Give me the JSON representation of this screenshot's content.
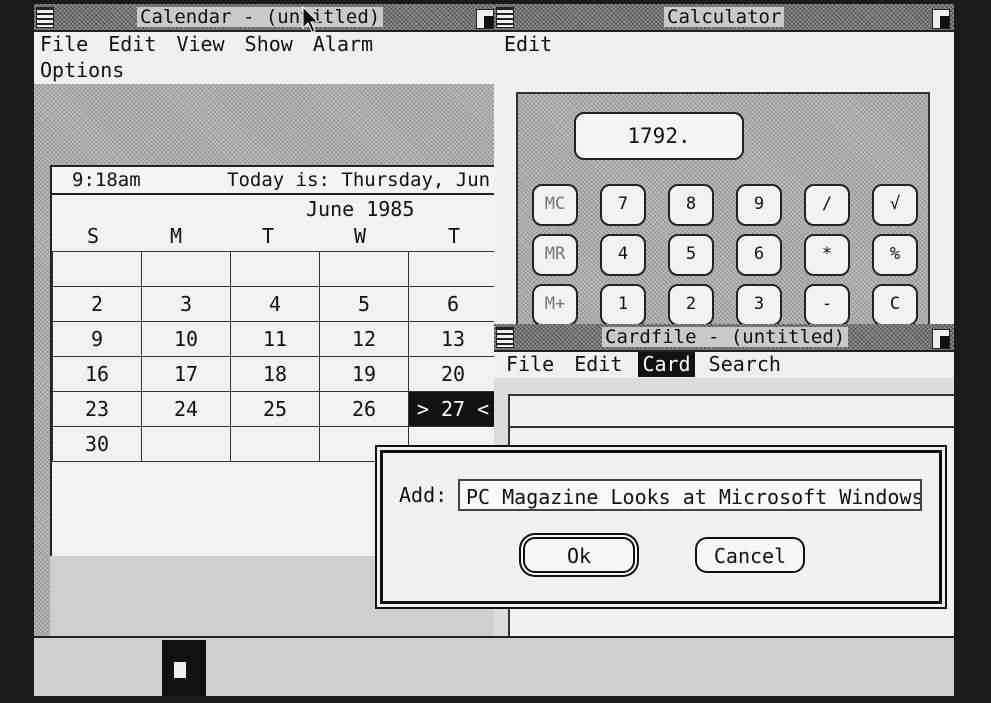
{
  "calendar": {
    "title": "Calendar - (untitled)",
    "menu": [
      "File",
      "Edit",
      "View",
      "Show",
      "Alarm"
    ],
    "menu2": "Options",
    "time": "9:18am",
    "today_text": "Today is: Thursday, Jun",
    "month": "June 1985",
    "weekdays": [
      "S",
      "M",
      "T",
      "W",
      "T"
    ],
    "weeks": [
      [
        "",
        "",
        "",
        "",
        ""
      ],
      [
        "2",
        "3",
        "4",
        "5",
        "6"
      ],
      [
        "9",
        "10",
        "11",
        "12",
        "13"
      ],
      [
        "16",
        "17",
        "18",
        "19",
        "20"
      ],
      [
        "23",
        "24",
        "25",
        "26",
        "> 27 <"
      ],
      [
        "30",
        "",
        "",
        "",
        ""
      ]
    ],
    "today_cell": "> 27 <"
  },
  "calculator": {
    "title": "Calculator",
    "menu": [
      "Edit"
    ],
    "display": "1792.",
    "keys": [
      [
        "MC",
        "7",
        "8",
        "9",
        "/",
        "√"
      ],
      [
        "MR",
        "4",
        "5",
        "6",
        "*",
        "%"
      ],
      [
        "M+",
        "1",
        "2",
        "3",
        "-",
        "C"
      ]
    ]
  },
  "cardfile": {
    "title": "Cardfile - (untitled)",
    "menu": [
      "File",
      "Edit",
      "Card",
      "Search"
    ],
    "selected_menu": "Card"
  },
  "dialog": {
    "label": "Add:",
    "value": "PC Magazine Looks at Microsoft Windows",
    "ok": "Ok",
    "cancel": "Cancel"
  }
}
